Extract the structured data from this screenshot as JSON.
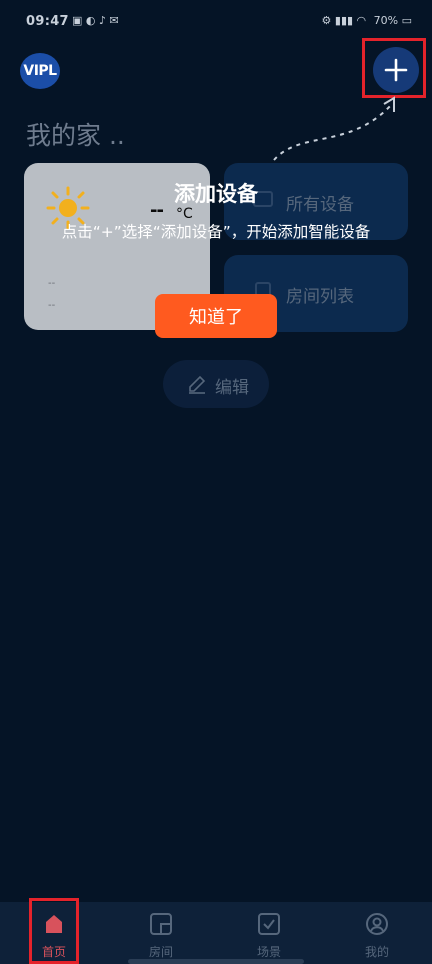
{
  "status_bar": {
    "time": "09:47",
    "battery": "70%"
  },
  "header": {
    "logo_text": "VIPL",
    "add_icon": "plus-icon"
  },
  "home": {
    "title": "我的家 .."
  },
  "weather": {
    "icon": "sun-icon",
    "temperature": "--",
    "unit": "°C",
    "stat_1": "--",
    "stat_2": "--"
  },
  "cards": {
    "all_devices": "所有设备",
    "room_list": "房间列表",
    "edit": "编辑"
  },
  "tip": {
    "title": "添加设备",
    "text": "点击“+”选择“添加设备”，开始添加智能设备",
    "ok_button": "知道了"
  },
  "tabs": [
    {
      "label": "首页",
      "icon": "home-icon",
      "active": true
    },
    {
      "label": "房间",
      "icon": "room-icon",
      "active": false
    },
    {
      "label": "场景",
      "icon": "scene-icon",
      "active": false
    },
    {
      "label": "我的",
      "icon": "profile-icon",
      "active": false
    }
  ],
  "colors": {
    "background": "#051426",
    "accent": "#ff5a1f",
    "highlight_border": "#e4232b",
    "active_tab": "#d8525c"
  }
}
